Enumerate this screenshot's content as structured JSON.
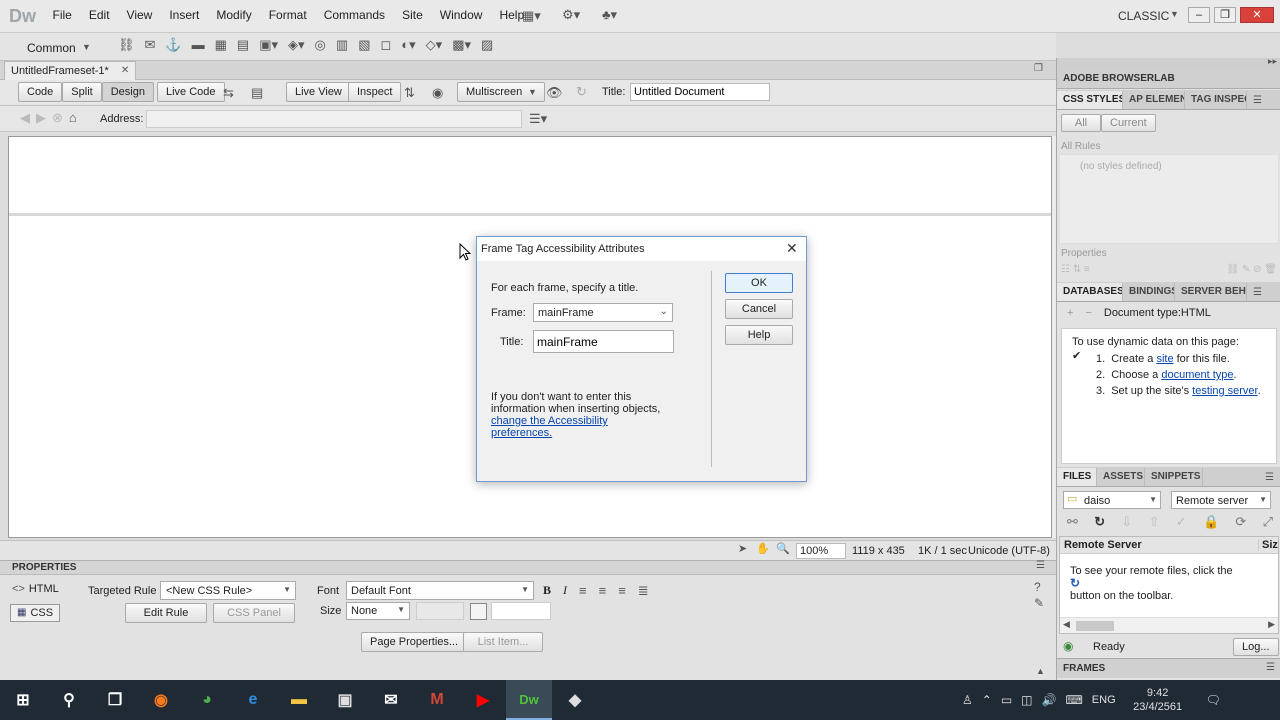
{
  "app": {
    "logo": "Dw",
    "menu": [
      "File",
      "Edit",
      "View",
      "Insert",
      "Modify",
      "Format",
      "Commands",
      "Site",
      "Window",
      "Help"
    ],
    "workspace": "CLASSIC"
  },
  "insertbar": {
    "category": "Common"
  },
  "doc": {
    "tab_name": "UntitledFrameset-1*",
    "view_buttons": [
      "Code",
      "Split",
      "Design"
    ],
    "live_code": "Live Code",
    "live_view": "Live View",
    "inspect": "Inspect",
    "multiscreen": "Multiscreen",
    "title_label": "Title:",
    "title_value": "Untitled Document",
    "address_label": "Address:",
    "address_value": ""
  },
  "statusbar": {
    "zoom": "100%",
    "dimensions": "1119 x 435",
    "download": "1K / 1 sec",
    "encoding": "Unicode (UTF-8)"
  },
  "dialog": {
    "title": "Frame Tag Accessibility Attributes",
    "instruction": "For each frame, specify a title.",
    "frame_label": "Frame:",
    "frame_value": "mainFrame",
    "title_label": "Title:",
    "title_value": "mainFrame",
    "note": "If you don't want to enter this information when inserting objects,",
    "link": "change the Accessibility preferences.",
    "ok": "OK",
    "cancel": "Cancel",
    "help": "Help"
  },
  "properties": {
    "header": "PROPERTIES",
    "html": "HTML",
    "css": "CSS",
    "targeted_rule_label": "Targeted Rule",
    "targeted_rule_value": "<New CSS Rule>",
    "edit_rule": "Edit Rule",
    "css_panel": "CSS Panel",
    "font_label": "Font",
    "font_value": "Default Font",
    "size_label": "Size",
    "size_value": "None",
    "page_properties": "Page Properties...",
    "list_item": "List Item..."
  },
  "right": {
    "browserlab": "ADOBE BROWSERLAB",
    "css_tabs": [
      "CSS STYLES",
      "AP ELEMENT",
      "TAG INSPEC"
    ],
    "all": "All",
    "current": "Current",
    "all_rules": "All Rules",
    "no_styles": "(no styles defined)",
    "properties": "Properties",
    "db_tabs": [
      "DATABASES",
      "BINDINGS",
      "SERVER BEHA"
    ],
    "doc_type": "Document type:HTML",
    "dynamic_intro": "To use dynamic data on this page:",
    "steps": [
      {
        "n": "1.",
        "pre": "Create a ",
        "link": "site",
        "post": " for this file."
      },
      {
        "n": "2.",
        "pre": "Choose a ",
        "link": "document type",
        "post": "."
      },
      {
        "n": "3.",
        "pre": "Set up the site's ",
        "link": "testing server",
        "post": "."
      }
    ],
    "files_tabs": [
      "FILES",
      "ASSETS",
      "SNIPPETS"
    ],
    "site": "daiso",
    "server_view": "Remote server",
    "remote_header": "Remote Server",
    "size_col": "Siz",
    "remote_msg1": "To see your remote files, click the",
    "remote_msg2": "button on the toolbar.",
    "ready": "Ready",
    "log": "Log...",
    "frames": "FRAMES"
  },
  "taskbar": {
    "lang": "ENG",
    "time": "9:42",
    "date": "23/4/2561"
  }
}
